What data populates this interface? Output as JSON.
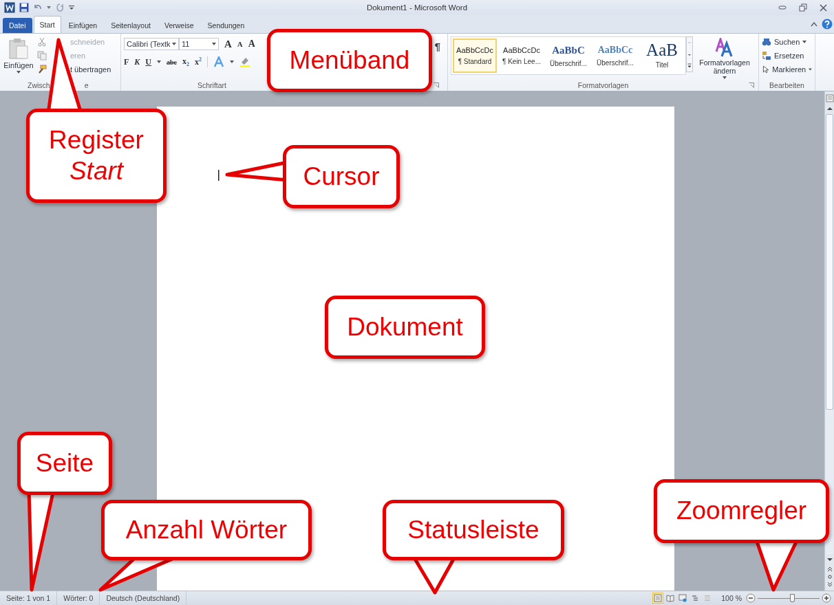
{
  "window": {
    "title": "Dokument1 - Microsoft Word"
  },
  "tabs": [
    {
      "label": "Datei",
      "kind": "file",
      "selected": false
    },
    {
      "label": "Start",
      "kind": "tab",
      "selected": true
    },
    {
      "label": "Einfügen",
      "kind": "tab",
      "selected": false
    },
    {
      "label": "Seitenlayout",
      "kind": "tab",
      "selected": false
    },
    {
      "label": "Verweise",
      "kind": "tab",
      "selected": false
    },
    {
      "label": "Sendungen",
      "kind": "tab",
      "selected": false
    }
  ],
  "ribbon": {
    "clipboard": {
      "paste": "Einfügen",
      "group_label_parts": [
        "Zwisch",
        "e"
      ],
      "items": [
        {
          "label": "schneiden",
          "kind": "scissors",
          "disabled": true
        },
        {
          "label": "eren",
          "kind": "copy",
          "disabled": true
        },
        {
          "label": "t übertragen",
          "kind": "brush",
          "disabled": false
        }
      ]
    },
    "font": {
      "font_name": "Calibri (Textk",
      "font_size": "11",
      "size_buttons": [
        "A",
        "A"
      ],
      "clear_button": "A",
      "group_label": "Schriftart",
      "format_buttons": [
        {
          "text": "F",
          "kind": "bold",
          "dropdown": false
        },
        {
          "text": "K",
          "kind": "italic",
          "dropdown": false
        },
        {
          "text": "U",
          "kind": "underline",
          "dropdown": true
        },
        {
          "text": "abc",
          "kind": "strike",
          "dropdown": false
        },
        {
          "text": "x$_{2}$",
          "kind": "sub",
          "dropdown": false
        },
        {
          "text": "x$^{2}$",
          "kind": "sup",
          "dropdown": false
        }
      ]
    },
    "paragraph": {
      "pilcrow": "¶"
    },
    "styles": {
      "group_label": "Formatvorlagen",
      "change": "Formatvorlagen ändern",
      "tiles": [
        {
          "preview": "AaBbCcDc",
          "name": "¶ Standard",
          "kind": "normal",
          "selected": true
        },
        {
          "preview": "AaBbCcDc",
          "name": "¶ Kein Lee...",
          "kind": "normal",
          "selected": false
        },
        {
          "preview": "AaBbC",
          "name": "Überschrif...",
          "kind": "heading1",
          "selected": false
        },
        {
          "preview": "AaBbCc",
          "name": "Überschrif...",
          "kind": "heading2",
          "selected": false
        },
        {
          "preview": "AaB",
          "name": "Titel",
          "kind": "title",
          "selected": false
        }
      ]
    },
    "editing": {
      "group_label": "Bearbeiten",
      "items": [
        {
          "label": "Suchen",
          "kind": "find",
          "dropdown": true
        },
        {
          "label": "Ersetzen",
          "kind": "replace",
          "dropdown": false
        },
        {
          "label": "Markieren",
          "kind": "select",
          "dropdown": true
        }
      ]
    }
  },
  "status_bar": {
    "items": [
      "Seite: 1 von 1",
      "Wörter: 0",
      "Deutsch (Deutschland)"
    ],
    "views": [
      {
        "kind": "print",
        "selected": true
      },
      {
        "kind": "reading",
        "selected": false
      },
      {
        "kind": "web",
        "selected": false
      },
      {
        "kind": "outline",
        "selected": false
      },
      {
        "kind": "draft",
        "selected": false
      }
    ],
    "zoom": "100 %",
    "zoom_slider": {
      "level": 0.55
    }
  },
  "callouts": [
    {
      "text": "Menüband"
    },
    {
      "text": "Register *Start*"
    },
    {
      "text": "Cursor"
    },
    {
      "text": "Dokument"
    },
    {
      "text": "Seite"
    },
    {
      "text": "Anzahl Wörter"
    },
    {
      "text": "Statusleiste"
    },
    {
      "text": "Zoomregler"
    }
  ]
}
